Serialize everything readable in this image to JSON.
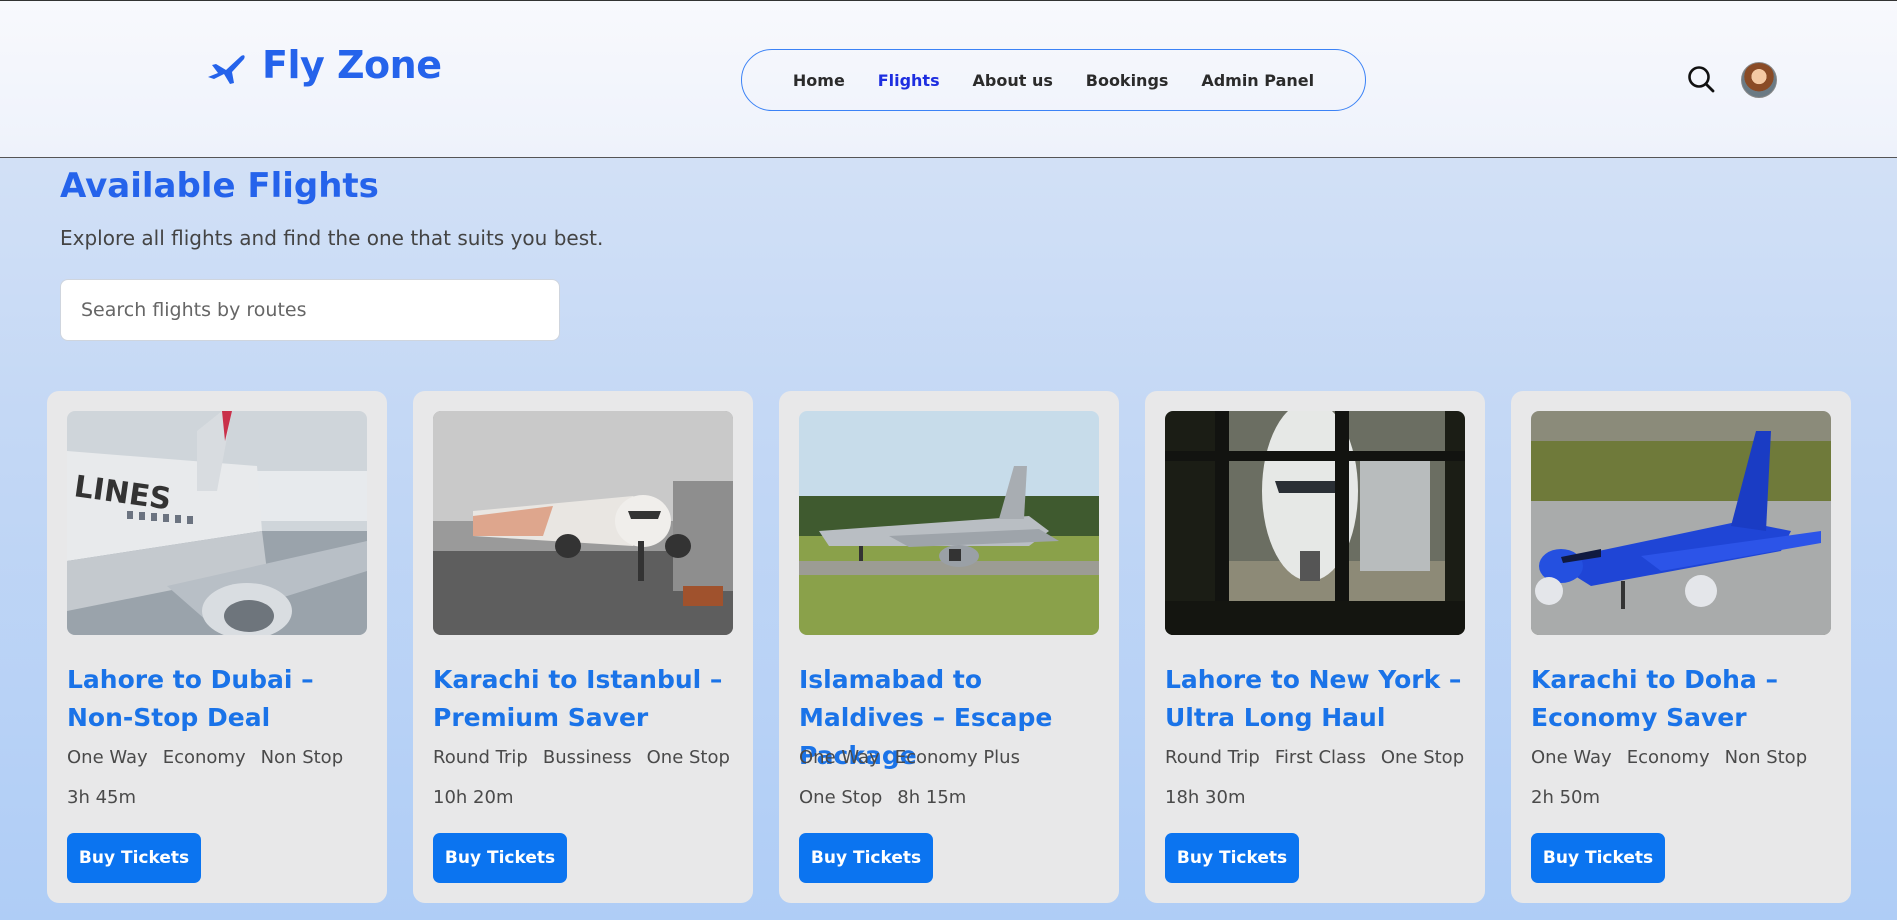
{
  "brand": {
    "name": "Fly Zone",
    "icon": "plane-icon",
    "color": "#2563eb"
  },
  "nav": {
    "items": [
      {
        "label": "Home",
        "active": false
      },
      {
        "label": "Flights",
        "active": true
      },
      {
        "label": "About us",
        "active": false
      },
      {
        "label": "Bookings",
        "active": false
      },
      {
        "label": "Admin Panel",
        "active": false
      }
    ]
  },
  "header_icons": {
    "search": "search-icon",
    "avatar": "user-avatar"
  },
  "main": {
    "title": "Available Flights",
    "subtitle": "Explore all flights and find the one that suits you best.",
    "search": {
      "placeholder": "Search flights by routes",
      "value": ""
    }
  },
  "flights": [
    {
      "title": "Lahore to Dubai – Non-Stop Deal",
      "tags": [
        "One Way",
        "Economy",
        "Non Stop",
        "3h 45m"
      ],
      "button": "Buy Tickets",
      "image": "airplane-at-snowy-gate"
    },
    {
      "title": "Karachi to Istanbul – Premium Saver",
      "tags": [
        "Round Trip",
        "Bussiness",
        "One Stop",
        "10h 20m"
      ],
      "button": "Buy Tickets",
      "image": "airplane-at-foggy-gate"
    },
    {
      "title": "Islamabad to Maldives – Escape Package",
      "tags": [
        "One Way",
        "Economy Plus",
        "One Stop",
        "8h 15m"
      ],
      "button": "Buy Tickets",
      "image": "grey-airplane-on-taxiway"
    },
    {
      "title": "Lahore to New York – Ultra Long Haul",
      "tags": [
        "Round Trip",
        "First Class",
        "One Stop",
        "18h 30m"
      ],
      "button": "Buy Tickets",
      "image": "airplane-through-window"
    },
    {
      "title": "Karachi to Doha – Economy Saver",
      "tags": [
        "One Way",
        "Economy",
        "Non Stop",
        "2h 50m"
      ],
      "button": "Buy Tickets",
      "image": "blue-airplane-on-tarmac"
    }
  ],
  "colors": {
    "accent": "#2563eb",
    "title_blue": "#1a73e8",
    "button": "#0b74f0",
    "active_nav": "#1d2ee0"
  }
}
